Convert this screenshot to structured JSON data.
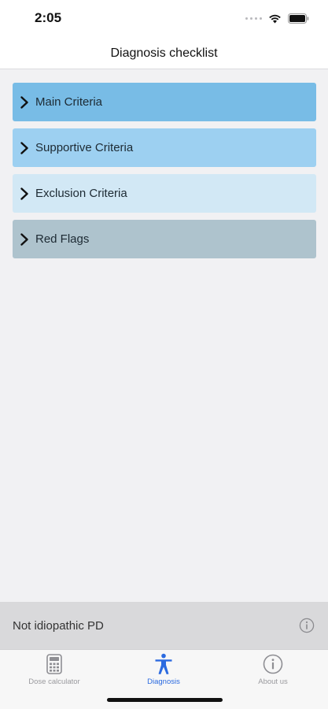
{
  "status_bar": {
    "time": "2:05"
  },
  "nav": {
    "title": "Diagnosis checklist"
  },
  "sections": [
    {
      "label": "Main Criteria",
      "color": "#78bce6"
    },
    {
      "label": "Supportive Criteria",
      "color": "#9dd0f1"
    },
    {
      "label": "Exclusion Criteria",
      "color": "#d2e8f5"
    },
    {
      "label": "Red Flags",
      "color": "#aec3cd"
    }
  ],
  "result": {
    "text": "Not idiopathic PD",
    "icon": "info-circle-icon"
  },
  "tabs": [
    {
      "label": "Dose calculator",
      "icon": "calculator-icon",
      "active": false
    },
    {
      "label": "Diagnosis",
      "icon": "person-icon",
      "active": true
    },
    {
      "label": "About us",
      "icon": "info-circle-icon",
      "active": false
    }
  ],
  "colors": {
    "accent": "#2b6ae0",
    "background": "#f1f1f3"
  }
}
